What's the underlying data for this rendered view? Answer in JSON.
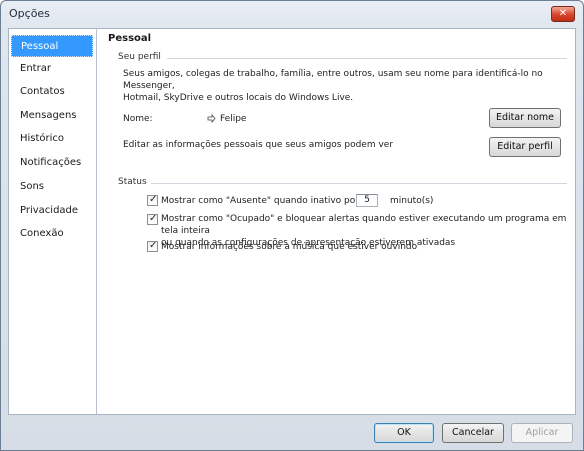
{
  "window": {
    "title": "Opções",
    "close_glyph": "✕"
  },
  "sidebar": {
    "items": [
      {
        "label": "Pessoal",
        "selected": true
      },
      {
        "label": "Entrar"
      },
      {
        "label": "Contatos"
      },
      {
        "label": "Mensagens"
      },
      {
        "label": "Histórico"
      },
      {
        "label": "Notificações"
      },
      {
        "label": "Sons"
      },
      {
        "label": "Privacidade"
      },
      {
        "label": "Conexão"
      }
    ]
  },
  "pane": {
    "title": "Pessoal",
    "profile": {
      "section_title": "Seu perfil",
      "description_line1": "Seus amigos, colegas de trabalho, família, entre outros, usam seu nome para identificá-lo no Messenger,",
      "description_line2": "Hotmail, SkyDrive e outros locais do Windows Live.",
      "name_label": "Nome:",
      "name_value": "Felipe",
      "edit_name_button": "Editar nome",
      "edit_info_text": "Editar as informações pessoais que seus amigos podem ver",
      "edit_profile_button": "Editar perfil"
    },
    "status": {
      "section_title": "Status",
      "away_label": "Mostrar como \"Ausente\" quando inativo por",
      "away_minutes": "5",
      "away_unit": "minuto(s)",
      "busy_label_line1": "Mostrar como \"Ocupado\" e bloquear alertas quando estiver executando um programa em tela inteira",
      "busy_label_line2": "ou quando as configurações de apresentação estiverem ativadas",
      "music_label": "Mostrar informações sobre a música que estiver ouvindo"
    }
  },
  "footer": {
    "ok_button": "OK",
    "cancel_button": "Cancelar",
    "apply_button": "Aplicar"
  }
}
